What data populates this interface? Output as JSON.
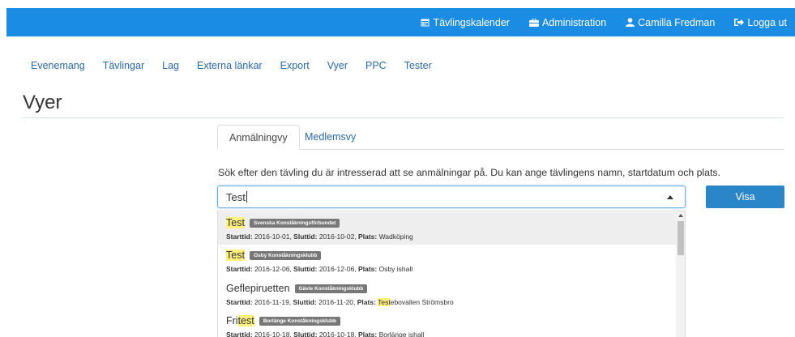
{
  "navbar": {
    "links": [
      {
        "label": "Tävlingskalender",
        "icon": "calendar-icon"
      },
      {
        "label": "Administration",
        "icon": "briefcase-icon"
      },
      {
        "label": "Camilla Fredman",
        "icon": "user-icon"
      },
      {
        "label": "Logga ut",
        "icon": "logout-icon"
      }
    ],
    "color": "#1b8ce3"
  },
  "submenu": [
    "Evenemang",
    "Tävlingar",
    "Lag",
    "Externa länkar",
    "Export",
    "Vyer",
    "PPC",
    "Tester"
  ],
  "page": {
    "title": "Vyer"
  },
  "tabs": [
    {
      "label": "Anmälningvy",
      "active": true
    },
    {
      "label": "Medlemsvy",
      "active": false
    }
  ],
  "description": "Sök efter den tävling du är intresserad att se anmälningar på. Du kan ange tävlingens namn, startdatum och plats.",
  "search": {
    "value": "Test",
    "button_label": "Visa"
  },
  "labels": {
    "start": "Starttid:",
    "end": "Sluttid:",
    "place": "Plats:"
  },
  "results": [
    {
      "name_pre": "",
      "name_mark": "Test",
      "name_post": "",
      "club": "Svenska Konståkningsförbundet",
      "start": " 2016-10-01, ",
      "end": " 2016-10-02, ",
      "place_pre": " ",
      "place_mark": "",
      "place_post": "Wadköping"
    },
    {
      "name_pre": "",
      "name_mark": "Test",
      "name_post": "",
      "club": "Osby Konståkningsklubb",
      "start": " 2016-12-06, ",
      "end": " 2016-12-06, ",
      "place_pre": " ",
      "place_mark": "",
      "place_post": "Osby ishall"
    },
    {
      "name_pre": "Geflepiruetten",
      "name_mark": "",
      "name_post": "",
      "club": "Gävle Konståkningsklubb",
      "start": " 2016-11-19, ",
      "end": " 2016-11-20, ",
      "place_pre": " ",
      "place_mark": "Test",
      "place_post": "ebovallen Strömsbro"
    },
    {
      "name_pre": "Fri",
      "name_mark": "test",
      "name_post": "",
      "club": "Borlänge Konståkningsklubb",
      "start": " 2016-10-18, ",
      "end": " 2016-10-18, ",
      "place_pre": " ",
      "place_mark": "",
      "place_post": "Borlänge ishall"
    }
  ]
}
